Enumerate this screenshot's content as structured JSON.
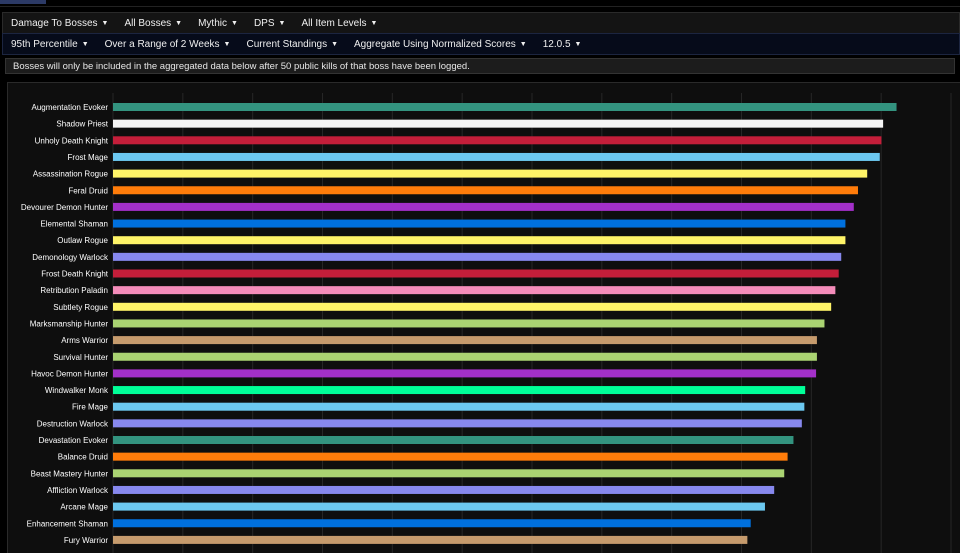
{
  "filters": {
    "row1": [
      {
        "label": "Damage To Bosses"
      },
      {
        "label": "All Bosses"
      },
      {
        "label": "Mythic"
      },
      {
        "label": "DPS"
      },
      {
        "label": "All Item Levels"
      }
    ],
    "row2": [
      {
        "label": "95th Percentile"
      },
      {
        "label": "Over a Range of 2 Weeks"
      },
      {
        "label": "Current Standings"
      },
      {
        "label": "Aggregate Using Normalized Scores"
      },
      {
        "label": "12.0.5"
      }
    ]
  },
  "notice": "Bosses will only be included in the aggregated data below after 50 public kills of that boss have been logged.",
  "chart_data": {
    "type": "bar",
    "orientation": "horizontal",
    "grid": true,
    "xlim": [
      0,
      100
    ],
    "series": [
      {
        "categories": [
          "Augmentation Evoker",
          "Shadow Priest",
          "Unholy Death Knight",
          "Frost Mage",
          "Assassination Rogue",
          "Feral Druid",
          "Devourer Demon Hunter",
          "Elemental Shaman",
          "Outlaw Rogue",
          "Demonology Warlock",
          "Frost Death Knight",
          "Retribution Paladin",
          "Subtlety Rogue",
          "Marksmanship Hunter",
          "Arms Warrior",
          "Survival Hunter",
          "Havoc Demon Hunter",
          "Windwalker Monk",
          "Fire Mage",
          "Destruction Warlock",
          "Devastation Evoker",
          "Balance Druid",
          "Beast Mastery Hunter",
          "Affliction Warlock",
          "Arcane Mage",
          "Enhancement Shaman",
          "Fury Warrior"
        ],
        "values": [
          93.5,
          91.9,
          91.7,
          91.5,
          90.0,
          88.9,
          88.4,
          87.4,
          87.4,
          86.9,
          86.6,
          86.2,
          85.7,
          84.9,
          84.0,
          84.0,
          83.9,
          82.6,
          82.5,
          82.2,
          81.2,
          80.5,
          80.1,
          78.9,
          77.8,
          76.1,
          75.7
        ],
        "colors": [
          "#33937f",
          "#f5f5f5",
          "#c41e3a",
          "#6cc8f0",
          "#fff468",
          "#ff7c0a",
          "#a330c9",
          "#0070dd",
          "#fff468",
          "#8788ee",
          "#c41e3a",
          "#f48cba",
          "#fff468",
          "#aad372",
          "#c69b6d",
          "#aad372",
          "#a330c9",
          "#00ff98",
          "#6cc8f0",
          "#8788ee",
          "#33937f",
          "#ff7c0a",
          "#aad372",
          "#8788ee",
          "#6cc8f0",
          "#0070dd",
          "#c69b6d"
        ]
      }
    ]
  }
}
